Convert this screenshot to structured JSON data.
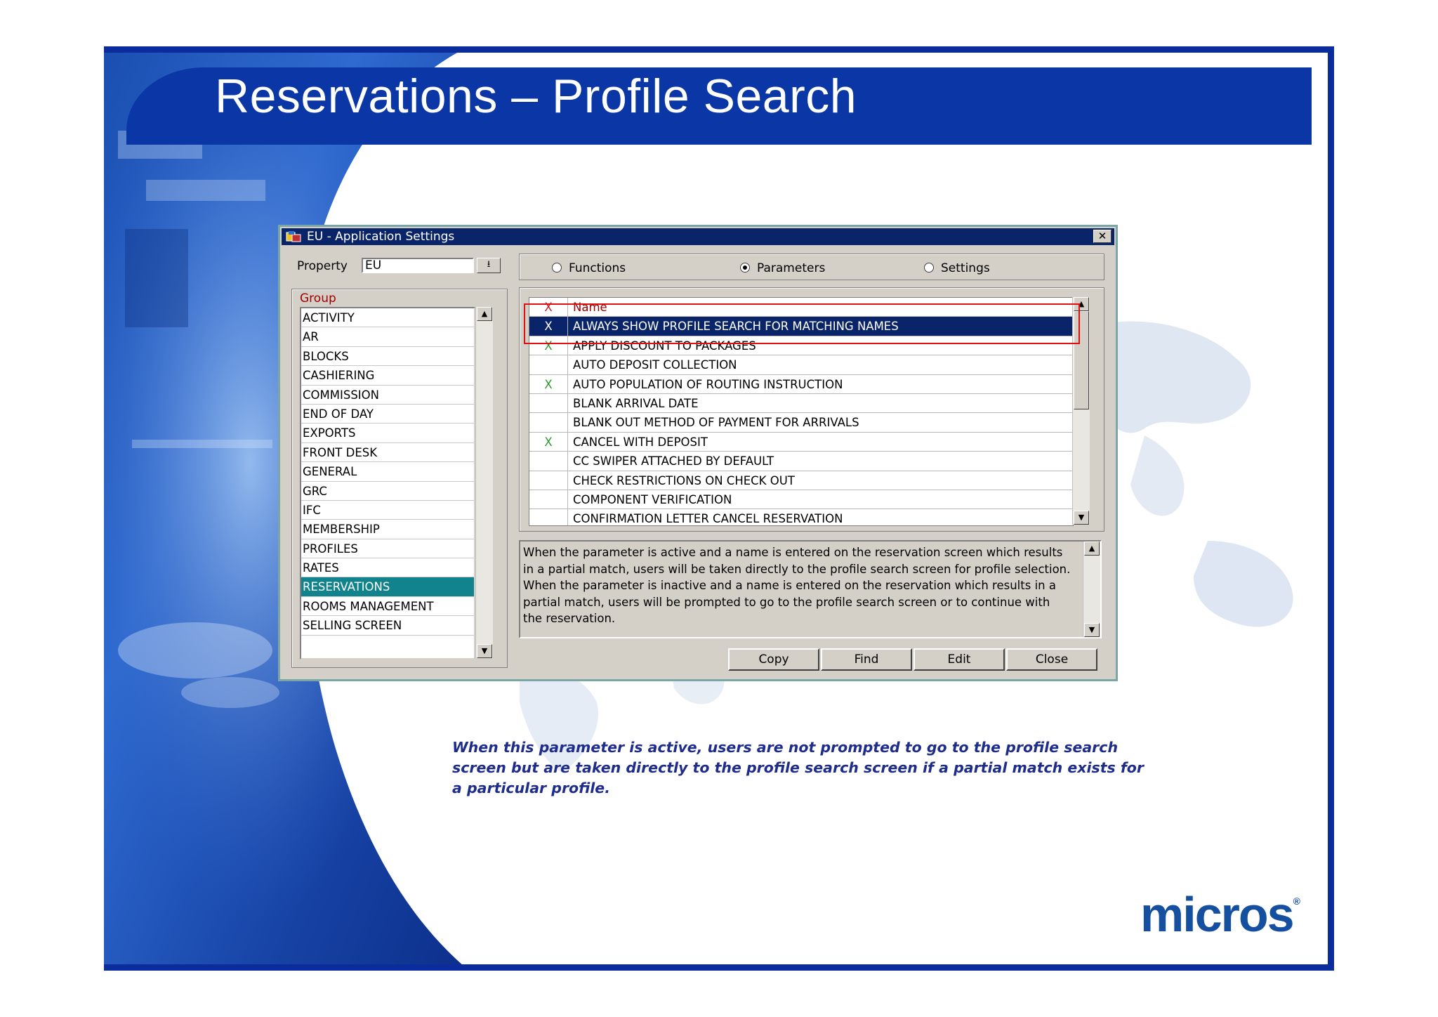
{
  "slide": {
    "title": "Reservations – Profile Search",
    "caption": "When this parameter is active, users are not prompted to go to the profile search screen but are taken directly to the profile search screen if a partial match exists for a particular profile.",
    "logo": "micros",
    "logo_mark": "®"
  },
  "dialog": {
    "title": "EU - Application Settings",
    "close_glyph": "✕",
    "property_label": "Property",
    "property_value": "EU",
    "property_dropdown_glyph": "⭳",
    "group_title": "Group",
    "groups": [
      "ACTIVITY",
      "AR",
      "BLOCKS",
      "CASHIERING",
      "COMMISSION",
      "END OF DAY",
      "EXPORTS",
      "FRONT DESK",
      "GENERAL",
      "GRC",
      "IFC",
      "MEMBERSHIP",
      "PROFILES",
      "RATES",
      "RESERVATIONS",
      "ROOMS MANAGEMENT",
      "SELLING SCREEN"
    ],
    "selected_group": "RESERVATIONS",
    "radios": [
      {
        "label": "Functions",
        "checked": false
      },
      {
        "label": "Parameters",
        "checked": true
      },
      {
        "label": "Settings",
        "checked": false
      }
    ],
    "table_header": {
      "check": "X",
      "name": "Name"
    },
    "parameters": [
      {
        "check": "X",
        "name": "ALWAYS SHOW PROFILE SEARCH FOR MATCHING NAMES",
        "selected": true
      },
      {
        "check": "X",
        "name": "APPLY DISCOUNT TO PACKAGES",
        "selected": false
      },
      {
        "check": "",
        "name": "AUTO DEPOSIT COLLECTION",
        "selected": false
      },
      {
        "check": "X",
        "name": "AUTO POPULATION OF ROUTING INSTRUCTION",
        "selected": false
      },
      {
        "check": "",
        "name": "BLANK ARRIVAL DATE",
        "selected": false
      },
      {
        "check": "",
        "name": "BLANK OUT METHOD OF PAYMENT FOR ARRIVALS",
        "selected": false
      },
      {
        "check": "X",
        "name": "CANCEL WITH DEPOSIT",
        "selected": false
      },
      {
        "check": "",
        "name": "CC SWIPER ATTACHED BY DEFAULT",
        "selected": false
      },
      {
        "check": "",
        "name": "CHECK RESTRICTIONS ON CHECK OUT",
        "selected": false
      },
      {
        "check": "",
        "name": "COMPONENT VERIFICATION",
        "selected": false
      },
      {
        "check": "",
        "name": "CONFIRMATION LETTER CANCEL RESERVATION",
        "selected": false
      }
    ],
    "description": "When the parameter is active and a name is entered on the reservation screen which results in a partial match, users will be taken directly to the profile search screen for profile selection.  When the parameter is inactive and a name is entered on the reservation which results in a partial match, users will be prompted to go to the profile search screen or to continue with the reservation.",
    "buttons": {
      "copy": "Copy",
      "find": "Find",
      "edit": "Edit",
      "close": "Close"
    },
    "scroll_up_glyph": "▲",
    "scroll_down_glyph": "▼"
  },
  "colors": {
    "title_bar": "#0a36a6",
    "selection": "#0a246a",
    "group_selection": "#11838c",
    "highlight_box": "#e01010",
    "caption": "#1e2c8c"
  }
}
